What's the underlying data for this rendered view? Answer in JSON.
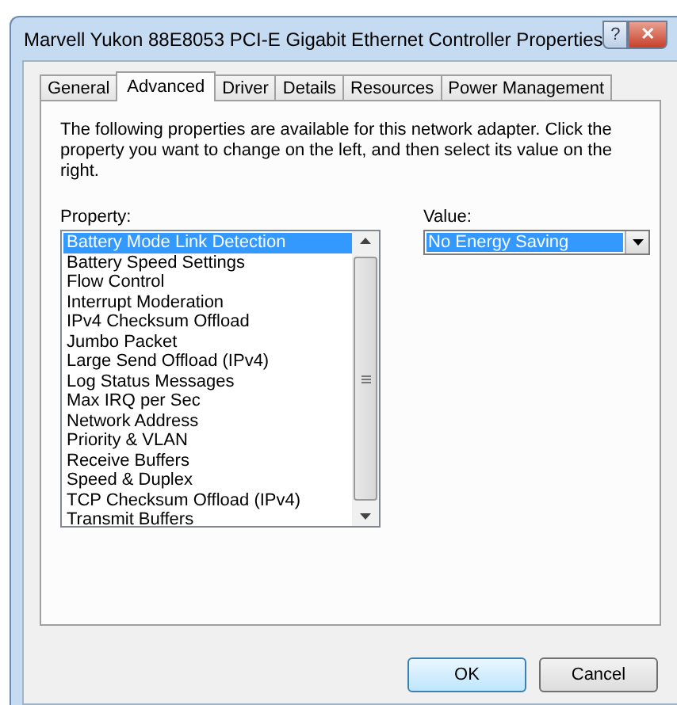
{
  "window": {
    "title": "Marvell Yukon 88E8053 PCI-E Gigabit Ethernet Controller Properties",
    "help_button": "?",
    "close_button": "✕"
  },
  "tabs": [
    {
      "label": "General",
      "selected": false
    },
    {
      "label": "Advanced",
      "selected": true
    },
    {
      "label": "Driver",
      "selected": false
    },
    {
      "label": "Details",
      "selected": false
    },
    {
      "label": "Resources",
      "selected": false
    },
    {
      "label": "Power Management",
      "selected": false
    }
  ],
  "description": "The following properties are available for this network adapter. Click the property you want to change on the left, and then select its value on the right.",
  "property": {
    "label": "Property:",
    "items": [
      {
        "label": "Battery Mode Link Detection",
        "selected": true
      },
      {
        "label": "Battery Speed Settings",
        "selected": false
      },
      {
        "label": "Flow Control",
        "selected": false
      },
      {
        "label": "Interrupt Moderation",
        "selected": false
      },
      {
        "label": "IPv4 Checksum Offload",
        "selected": false
      },
      {
        "label": "Jumbo Packet",
        "selected": false
      },
      {
        "label": "Large Send Offload (IPv4)",
        "selected": false
      },
      {
        "label": "Log Status Messages",
        "selected": false
      },
      {
        "label": "Max IRQ per Sec",
        "selected": false
      },
      {
        "label": "Network Address",
        "selected": false
      },
      {
        "label": "Priority & VLAN",
        "selected": false
      },
      {
        "label": "Receive Buffers",
        "selected": false
      },
      {
        "label": "Speed & Duplex",
        "selected": false
      },
      {
        "label": "TCP Checksum Offload (IPv4)",
        "selected": false
      },
      {
        "label": "Transmit Buffers",
        "selected": false
      }
    ]
  },
  "value": {
    "label": "Value:",
    "selected_value": "No Energy Saving"
  },
  "buttons": [
    {
      "label": "OK",
      "default": true
    },
    {
      "label": "Cancel",
      "default": false
    }
  ]
}
